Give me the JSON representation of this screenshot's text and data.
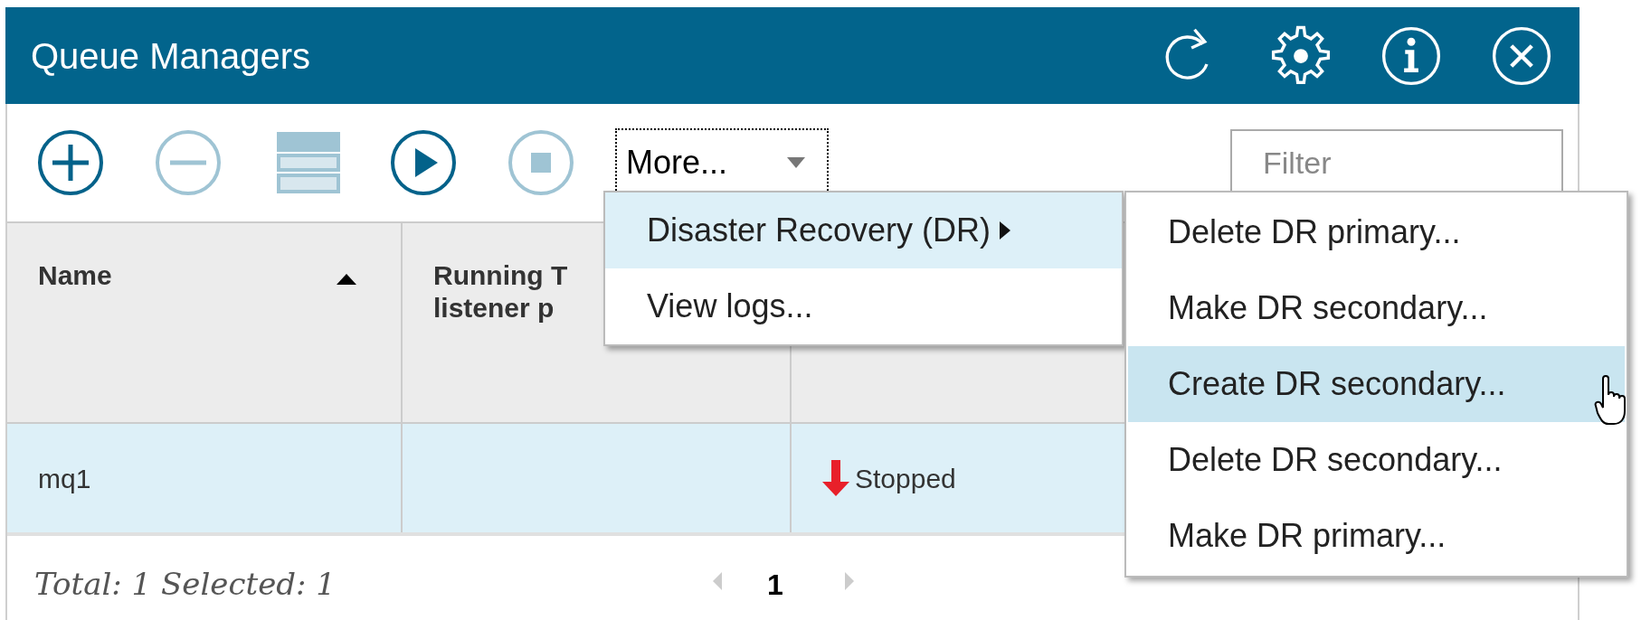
{
  "window": {
    "title": "Queue Managers"
  },
  "header_buttons": [
    {
      "kind": "refresh"
    },
    {
      "kind": "settings"
    },
    {
      "kind": "info"
    },
    {
      "kind": "close"
    }
  ],
  "toolbar": [
    {
      "kind": "add",
      "disabled": false
    },
    {
      "kind": "remove",
      "disabled": true
    },
    {
      "kind": "server",
      "disabled": true
    },
    {
      "kind": "start",
      "disabled": false
    },
    {
      "kind": "stop",
      "disabled": true
    }
  ],
  "more_button": {
    "label": "More..."
  },
  "filter": {
    "placeholder": "Filter"
  },
  "table": {
    "columns": [
      {
        "lines": [
          "Name"
        ],
        "sorted": true
      },
      {
        "lines": [
          "Running T",
          "listener p"
        ],
        "sorted": false
      }
    ],
    "rows": [
      {
        "selected": true,
        "cells": [
          "mq1",
          "",
          {
            "kind": "stopped",
            "text": "Stopped"
          }
        ]
      }
    ]
  },
  "status_bar": {
    "summary": "Total: 1 Selected: 1",
    "page": "1"
  },
  "menu": {
    "items": [
      {
        "label": "Disaster Recovery (DR)",
        "submenu": true,
        "selected": true
      },
      {
        "label": "View logs...",
        "submenu": false,
        "selected": false
      }
    ]
  },
  "submenu": {
    "items": [
      {
        "label": "Delete DR primary...",
        "selected": false
      },
      {
        "label": "Make DR secondary...",
        "selected": false
      },
      {
        "label": "Create DR secondary...",
        "selected": true
      },
      {
        "label": "Delete DR secondary...",
        "selected": false
      },
      {
        "label": "Make DR primary...",
        "selected": false
      }
    ]
  }
}
